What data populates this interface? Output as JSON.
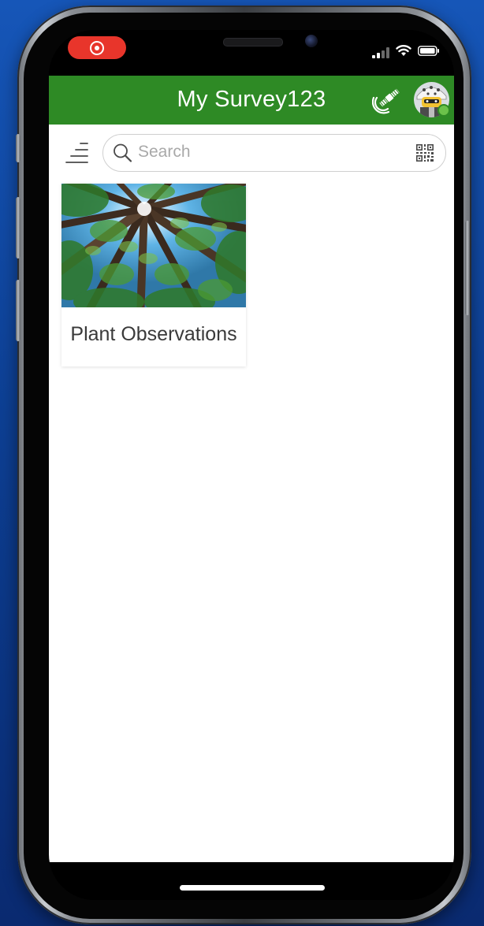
{
  "status_bar": {
    "recording_indicator": "screen-record-icon",
    "signal_icon": "cellular-signal-icon",
    "wifi_icon": "wifi-icon",
    "battery_icon": "battery-icon",
    "record_color": "#e8352b"
  },
  "header": {
    "title": "My Survey123",
    "gps_icon": "satellite-gps-icon",
    "avatar_icon": "user-avatar",
    "background_color": "#2e8a25",
    "online_status_color": "#6cc24a"
  },
  "toolbar": {
    "menu_icon": "sort-menu-icon",
    "search_placeholder": "Search",
    "search_value": "",
    "qr_icon": "qr-code-scanner-icon"
  },
  "surveys": [
    {
      "title": "Plant Observations",
      "thumbnail": "forest-canopy-photo"
    }
  ]
}
